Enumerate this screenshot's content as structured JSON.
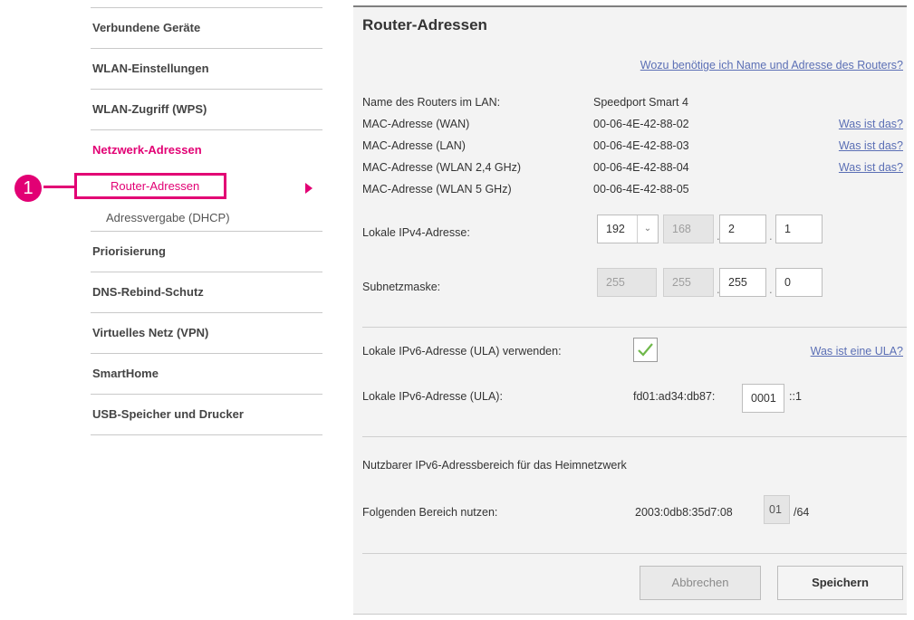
{
  "sidebar": {
    "items_top": [
      {
        "label": "Verbundene Geräte"
      },
      {
        "label": "WLAN-Einstellungen"
      },
      {
        "label": "WLAN-Zugriff (WPS)"
      }
    ],
    "group": {
      "label": "Netzwerk-Adressen",
      "sub_active": "Router-Adressen",
      "sub_other": "Adressvergabe (DHCP)"
    },
    "items_bottom": [
      {
        "label": "Priorisierung"
      },
      {
        "label": "DNS-Rebind-Schutz"
      },
      {
        "label": "Virtuelles Netz (VPN)"
      },
      {
        "label": "SmartHome"
      },
      {
        "label": "USB-Speicher und Drucker"
      }
    ]
  },
  "callout": {
    "number": "1"
  },
  "panel": {
    "title": "Router-Adressen",
    "help_link": "Wozu benötige ich Name und Adresse des Routers?",
    "router_name_label": "Name des Routers im LAN:",
    "router_name_value": "Speedport Smart 4",
    "mac_wan_label": "MAC-Adresse (WAN)",
    "mac_wan_value": "00-06-4E-42-88-02",
    "mac_lan_label": "MAC-Adresse (LAN)",
    "mac_lan_value": "00-06-4E-42-88-03",
    "mac_wlan24_label": "MAC-Adresse (WLAN 2,4 GHz)",
    "mac_wlan24_value": "00-06-4E-42-88-04",
    "mac_wlan5_label": "MAC-Adresse (WLAN 5 GHz)",
    "mac_wlan5_value": "00-06-4E-42-88-05",
    "what_is_link": "Was ist das?",
    "ipv4_label": "Lokale IPv4-Adresse:",
    "ipv4": [
      "192",
      "168",
      "2",
      "1"
    ],
    "subnet_label": "Subnetzmaske:",
    "subnet": [
      "255",
      "255",
      "255",
      "0"
    ],
    "ula_use_label": "Lokale IPv6-Adresse (ULA) verwenden:",
    "ula_checked": true,
    "ula_link": "Was ist eine ULA?",
    "ula_label": "Lokale IPv6-Adresse (ULA):",
    "ula_prefix": "fd01:ad34:db87:",
    "ula_input": "0001",
    "ula_suffix": "::1",
    "range_heading": "Nutzbarer IPv6-Adressbereich für das Heimnetzwerk",
    "range_label": "Folgenden Bereich nutzen:",
    "range_prefix": "2003:0db8:35d7:08",
    "range_input": "01",
    "range_suffix": "/64",
    "cancel_label": "Abbrechen",
    "save_label": "Speichern"
  },
  "colors": {
    "accent": "#e20074",
    "link": "#5b6fb5",
    "panel_bg": "#f3f3f3"
  }
}
